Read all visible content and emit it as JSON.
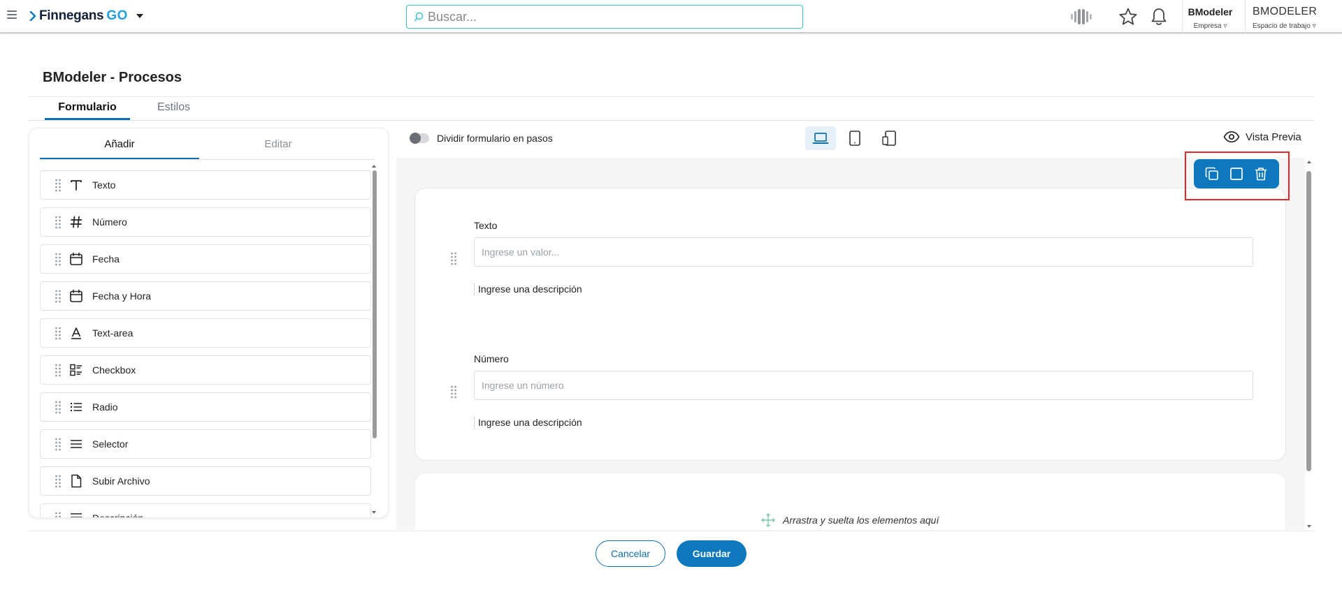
{
  "header": {
    "logo_name": "Finnegans",
    "logo_suffix": "GO",
    "search_placeholder": "Buscar...",
    "company": {
      "name": "BModeler",
      "label": "Empresa"
    },
    "workspace": {
      "name": "BMODELER",
      "label": "Espacio de trabajo"
    }
  },
  "page": {
    "title": "BModeler - Procesos",
    "tabs": [
      {
        "label": "Formulario",
        "active": true
      },
      {
        "label": "Estilos",
        "active": false
      }
    ]
  },
  "left_panel": {
    "tabs": [
      {
        "label": "Añadir",
        "active": true
      },
      {
        "label": "Editar",
        "active": false
      }
    ],
    "items": [
      {
        "label": "Texto",
        "icon": "text-type-icon"
      },
      {
        "label": "Número",
        "icon": "hash-icon"
      },
      {
        "label": "Fecha",
        "icon": "calendar-icon"
      },
      {
        "label": "Fecha y Hora",
        "icon": "calendar-icon"
      },
      {
        "label": "Text-area",
        "icon": "text-area-icon"
      },
      {
        "label": "Checkbox",
        "icon": "checklist-icon"
      },
      {
        "label": "Radio",
        "icon": "list-icon"
      },
      {
        "label": "Selector",
        "icon": "menu-lines-icon"
      },
      {
        "label": "Subir Archivo",
        "icon": "file-icon"
      },
      {
        "label": "Descripción",
        "icon": "description-icon"
      }
    ]
  },
  "toolbar": {
    "split_steps_label": "Dividir formulario en pasos",
    "split_steps_enabled": false,
    "devices": [
      {
        "name": "laptop",
        "active": true
      },
      {
        "name": "tablet",
        "active": false
      },
      {
        "name": "mobile",
        "active": false
      }
    ],
    "preview_label": "Vista Previa"
  },
  "form": {
    "fields": [
      {
        "label": "Texto",
        "placeholder": "Ingrese un valor...",
        "description": "Ingrese una descripción"
      },
      {
        "label": "Número",
        "placeholder": "Ingrese un número",
        "description": "Ingrese una descripción"
      }
    ],
    "dropzone_text": "Arrastra y suelta los elementos aquí",
    "element_actions": [
      "copy-icon",
      "square-icon",
      "trash-icon"
    ]
  },
  "footer": {
    "cancel_label": "Cancelar",
    "save_label": "Guardar"
  },
  "colors": {
    "primary": "#0d78bd",
    "highlight_box": "#e32626",
    "search_border": "#38c1d4"
  }
}
